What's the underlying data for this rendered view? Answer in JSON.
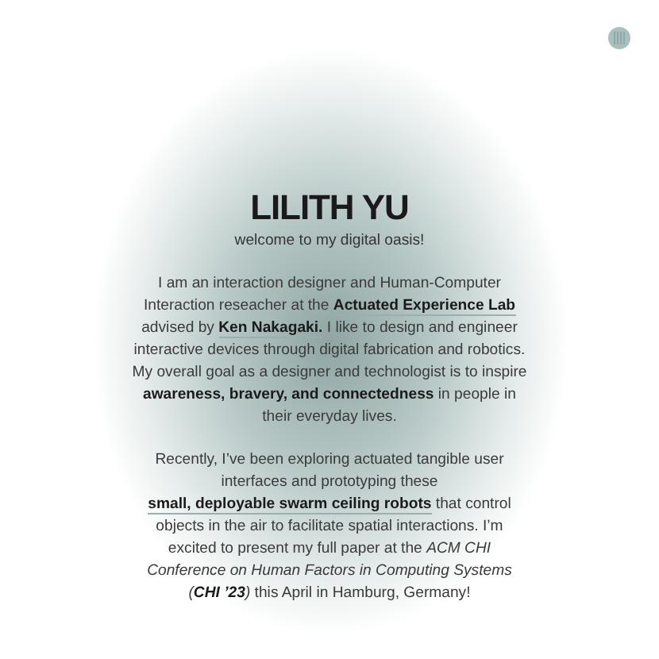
{
  "header": {
    "title": "LILITH YU",
    "subtitle": "welcome to my digital oasis!"
  },
  "paragraphs": [
    [
      {
        "kind": "text",
        "text": "I am an interaction designer and Human-Computer Interaction reseacher at the "
      },
      {
        "kind": "link",
        "text": "Actuated Experience Lab"
      },
      {
        "kind": "text",
        "text": " advised by "
      },
      {
        "kind": "link",
        "text": "Ken Nakagaki."
      },
      {
        "kind": "text",
        "text": " I like to design and engineer interactive devices through digital fabrication and robotics. My overall goal as a designer and technologist is to inspire "
      },
      {
        "kind": "bold",
        "text": "awareness, bravery, and connectedness"
      },
      {
        "kind": "text",
        "text": " in people in their everyday lives."
      }
    ],
    [
      {
        "kind": "text",
        "text": "Recently, I’ve been exploring actuated tangible user interfaces and prototyping these "
      },
      {
        "kind": "link",
        "text": "small, deployable swarm ceiling robots"
      },
      {
        "kind": "text",
        "text": " that control objects in the air to facilitate spatial interactions. I’m excited to present my full paper at the "
      },
      {
        "kind": "italic",
        "text": "ACM CHI Conference on Human Factors in Computing Systems ("
      },
      {
        "kind": "bold_italic",
        "text": "CHI ’23"
      },
      {
        "kind": "italic",
        "text": ")"
      },
      {
        "kind": "text",
        "text": " this April in Hamburg, Germany!"
      }
    ]
  ]
}
